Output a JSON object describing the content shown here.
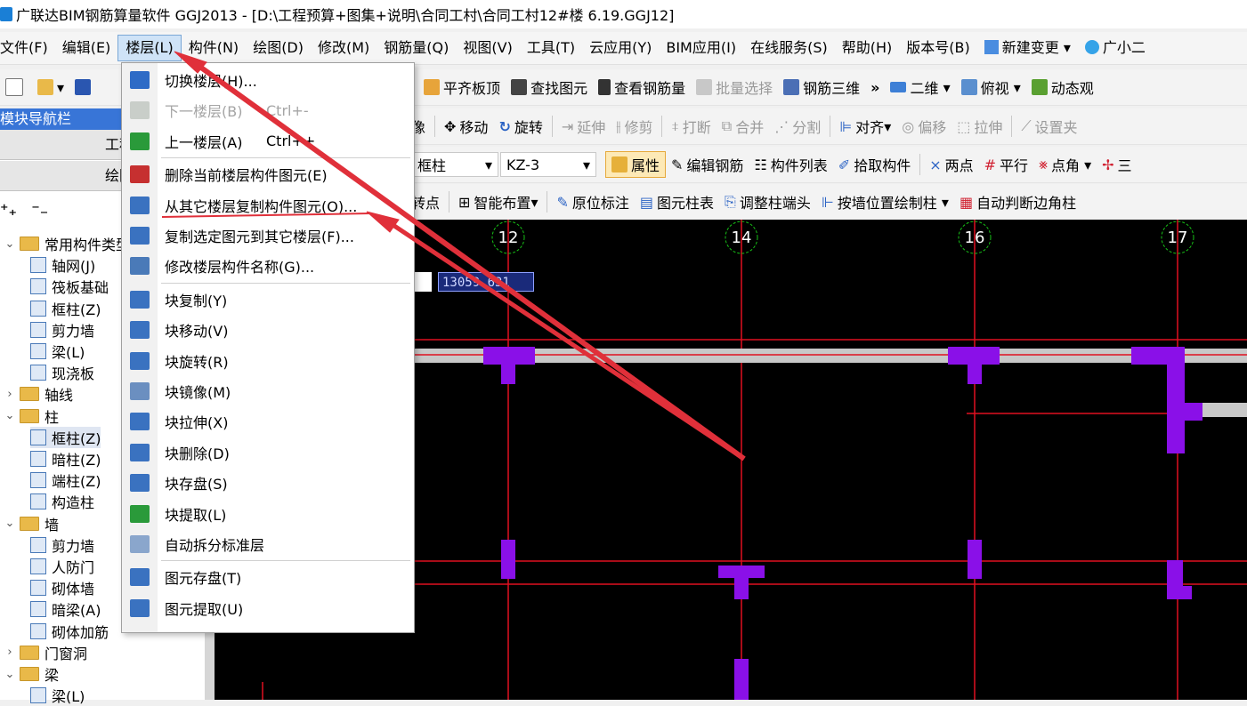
{
  "title_bar": {
    "text": "广联达BIM钢筋算量软件 GGJ2013 - [D:\\工程预算+图集+说明\\合同工村\\合同工村12#楼 6.19.GGJ12]"
  },
  "menubar": {
    "items": [
      "文件(F)",
      "编辑(E)",
      "楼层(L)",
      "构件(N)",
      "绘图(D)",
      "修改(M)",
      "钢筋量(Q)",
      "视图(V)",
      "工具(T)",
      "云应用(Y)",
      "BIM应用(I)",
      "在线服务(S)",
      "帮助(H)",
      "版本号(B)"
    ],
    "extra1": "新建变更",
    "extra2": "广小二"
  },
  "toolbar1": {
    "items": [
      "查",
      "平齐板顶",
      "查找图元",
      "查看钢筋量",
      "批量选择",
      "钢筋三维"
    ],
    "more": "»",
    "view_combo": "二维",
    "view2": "俯视",
    "view3": "动态观"
  },
  "toolbar2": {
    "items": [
      "像",
      "移动",
      "旋转",
      "延伸",
      "修剪",
      "打断",
      "合并",
      "分割",
      "对齐",
      "偏移",
      "拉伸",
      "设置夹"
    ]
  },
  "toolbar3": {
    "type_combo": "框柱",
    "name_combo": "KZ-3",
    "items": [
      "属性",
      "编辑钢筋",
      "构件列表",
      "拾取构件",
      "两点",
      "平行",
      "点角",
      "三"
    ]
  },
  "toolbar4": {
    "items": [
      "转点",
      "智能布置",
      "原位标注",
      "图元柱表",
      "调整柱端头",
      "按墙位置绘制柱",
      "自动判断边角柱"
    ]
  },
  "nav": {
    "header": "模块导航栏",
    "btn1": "工程设置",
    "btn2": "绘图输入"
  },
  "tree": [
    {
      "label": "常用构件类型",
      "level": 0,
      "kind": "folder",
      "expand": "v"
    },
    {
      "label": "轴网(J)",
      "level": 1,
      "kind": "item"
    },
    {
      "label": "筏板基础",
      "level": 1,
      "kind": "item"
    },
    {
      "label": "框柱(Z)",
      "level": 1,
      "kind": "item"
    },
    {
      "label": "剪力墙",
      "level": 1,
      "kind": "item"
    },
    {
      "label": "梁(L)",
      "level": 1,
      "kind": "item"
    },
    {
      "label": "现浇板",
      "level": 1,
      "kind": "item"
    },
    {
      "label": "轴线",
      "level": 0,
      "kind": "folder",
      "expand": ">"
    },
    {
      "label": "柱",
      "level": 0,
      "kind": "folder",
      "expand": "v"
    },
    {
      "label": "框柱(Z)",
      "level": 1,
      "kind": "item",
      "selected": true
    },
    {
      "label": "暗柱(Z)",
      "level": 1,
      "kind": "item"
    },
    {
      "label": "端柱(Z)",
      "level": 1,
      "kind": "item"
    },
    {
      "label": "构造柱",
      "level": 1,
      "kind": "item"
    },
    {
      "label": "墙",
      "level": 0,
      "kind": "folder",
      "expand": "v"
    },
    {
      "label": "剪力墙",
      "level": 1,
      "kind": "item"
    },
    {
      "label": "人防门",
      "level": 1,
      "kind": "item"
    },
    {
      "label": "砌体墙",
      "level": 1,
      "kind": "item"
    },
    {
      "label": "暗梁(A)",
      "level": 1,
      "kind": "item"
    },
    {
      "label": "砌体加筋",
      "level": 1,
      "kind": "item"
    },
    {
      "label": "门窗洞",
      "level": 0,
      "kind": "folder",
      "expand": ">"
    },
    {
      "label": "梁",
      "level": 0,
      "kind": "folder",
      "expand": "v"
    },
    {
      "label": "梁(L)",
      "level": 1,
      "kind": "item"
    }
  ],
  "floor_menu": [
    {
      "label": "切换楼层(H)...",
      "key": "",
      "disabled": false,
      "icon": "switch-floor-icon"
    },
    {
      "label": "下一楼层(B)",
      "key": "Ctrl+-",
      "disabled": true,
      "icon": "next-floor-icon"
    },
    {
      "label": "上一楼层(A)",
      "key": "Ctrl++",
      "disabled": false,
      "icon": "prev-floor-icon"
    },
    {
      "label": "删除当前楼层构件图元(E)",
      "key": "",
      "disabled": false,
      "icon": "delete-floor-icon"
    },
    {
      "label": "从其它楼层复制构件图元(O)...",
      "key": "",
      "disabled": false,
      "icon": "copy-from-floor-icon"
    },
    {
      "label": "复制选定图元到其它楼层(F)...",
      "key": "",
      "disabled": false,
      "icon": "copy-to-floor-icon"
    },
    {
      "label": "修改楼层构件名称(G)...",
      "key": "",
      "disabled": false,
      "icon": "rename-icon"
    },
    {
      "label": "块复制(Y)",
      "key": "",
      "disabled": false,
      "icon": "block-copy-icon"
    },
    {
      "label": "块移动(V)",
      "key": "",
      "disabled": false,
      "icon": "block-move-icon"
    },
    {
      "label": "块旋转(R)",
      "key": "",
      "disabled": false,
      "icon": "block-rotate-icon"
    },
    {
      "label": "块镜像(M)",
      "key": "",
      "disabled": false,
      "icon": "block-mirror-icon"
    },
    {
      "label": "块拉伸(X)",
      "key": "",
      "disabled": false,
      "icon": "block-stretch-icon"
    },
    {
      "label": "块删除(D)",
      "key": "",
      "disabled": false,
      "icon": "block-delete-icon"
    },
    {
      "label": "块存盘(S)",
      "key": "",
      "disabled": false,
      "icon": "block-save-icon"
    },
    {
      "label": "块提取(L)",
      "key": "",
      "disabled": false,
      "icon": "block-extract-icon"
    },
    {
      "label": "自动拆分标准层",
      "key": "",
      "disabled": false,
      "icon": "auto-split-icon"
    },
    {
      "label": "图元存盘(T)",
      "key": "",
      "disabled": false,
      "icon": "element-save-icon"
    },
    {
      "label": "图元提取(U)",
      "key": "",
      "disabled": false,
      "icon": "element-extract-icon"
    }
  ],
  "canvas": {
    "axis_labels": [
      "12",
      "14",
      "16",
      "17"
    ],
    "coordinate": "13059.631"
  },
  "colors": {
    "grid_line": "#e01020",
    "column": "#8a10e8",
    "wall": "#c8c8c8",
    "axis_bubble": "#17c017",
    "annotation_arrow": "#e0303a"
  }
}
